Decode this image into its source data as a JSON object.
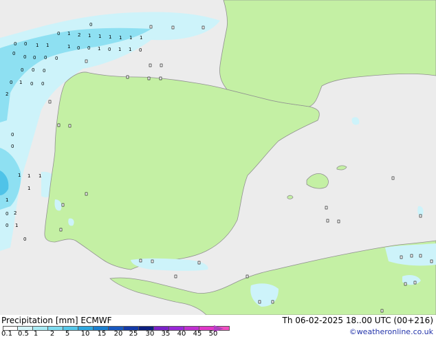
{
  "map": {
    "colors": {
      "sea": "#ececec",
      "land": "#c4f0a4",
      "precip_light": "#cdf3fa",
      "precip_mid": "#8ee0f2",
      "precip_strong": "#4fc3e8",
      "border": "#909090"
    },
    "precip_labels": [
      {
        "id": "a1",
        "text": "0"
      },
      {
        "id": "a2",
        "text": "1"
      },
      {
        "id": "a3",
        "text": "2"
      },
      {
        "id": "a4",
        "text": "1"
      },
      {
        "id": "a5",
        "text": "1"
      },
      {
        "id": "a6",
        "text": "1"
      },
      {
        "id": "a7",
        "text": "1"
      },
      {
        "id": "a8",
        "text": "1"
      },
      {
        "id": "a9",
        "text": "1"
      },
      {
        "id": "a10",
        "text": "0"
      },
      {
        "id": "b1",
        "text": "0"
      },
      {
        "id": "b2",
        "text": "0"
      },
      {
        "id": "b3",
        "text": "1"
      },
      {
        "id": "b4",
        "text": "1"
      },
      {
        "id": "b5",
        "text": "0"
      },
      {
        "id": "b6",
        "text": "0"
      },
      {
        "id": "b7",
        "text": "1"
      },
      {
        "id": "b8",
        "text": "0"
      },
      {
        "id": "b9",
        "text": "1"
      },
      {
        "id": "b10",
        "text": "1"
      },
      {
        "id": "b11",
        "text": "0"
      },
      {
        "id": "b12",
        "text": "1"
      },
      {
        "id": "b13",
        "text": "0"
      },
      {
        "id": "c1",
        "text": "0"
      },
      {
        "id": "c2",
        "text": "0"
      },
      {
        "id": "c3",
        "text": "0"
      },
      {
        "id": "c4",
        "text": "0"
      },
      {
        "id": "c5",
        "text": "0"
      },
      {
        "id": "c6",
        "text": "0"
      },
      {
        "id": "c7",
        "text": "0"
      },
      {
        "id": "c8",
        "text": "1"
      },
      {
        "id": "c9",
        "text": "0"
      },
      {
        "id": "c10",
        "text": "0"
      },
      {
        "id": "c11",
        "text": "0"
      },
      {
        "id": "c12",
        "text": "2"
      },
      {
        "id": "c13",
        "text": "0"
      },
      {
        "id": "c14",
        "text": "0"
      },
      {
        "id": "c15",
        "text": "1"
      },
      {
        "id": "c16",
        "text": "1"
      },
      {
        "id": "c17",
        "text": "1"
      },
      {
        "id": "c18",
        "text": "2"
      },
      {
        "id": "c19",
        "text": "0"
      },
      {
        "id": "c20",
        "text": "0"
      },
      {
        "id": "c21",
        "text": "1"
      },
      {
        "id": "c22",
        "text": "1"
      },
      {
        "id": "c23",
        "text": "1"
      },
      {
        "id": "c24",
        "text": "0"
      }
    ]
  },
  "legend": {
    "title": "Precipitation [mm]",
    "model": "ECMWF",
    "datetime": "Th 06-02-2025 18..00 UTC (00+216)",
    "credit": "©weatheronline.co.uk",
    "swatches": [
      {
        "color": "#ffffff"
      },
      {
        "color": "#d4f5fa"
      },
      {
        "color": "#a8ebf5"
      },
      {
        "color": "#7fdcf0"
      },
      {
        "color": "#56c8ea"
      },
      {
        "color": "#2fa8e0"
      },
      {
        "color": "#1a7fd0"
      },
      {
        "color": "#1858c0"
      },
      {
        "color": "#143aa8"
      },
      {
        "color": "#0c1f80"
      },
      {
        "color": "#7a22c8"
      },
      {
        "color": "#9a28d8"
      },
      {
        "color": "#c030d0"
      },
      {
        "color": "#e038c8"
      },
      {
        "color": "#f050c0"
      }
    ],
    "ticks": [
      "0.1",
      "0.5",
      "1",
      "2",
      "5",
      "10",
      "15",
      "20",
      "25",
      "30",
      "35",
      "40",
      "45",
      "50"
    ]
  }
}
